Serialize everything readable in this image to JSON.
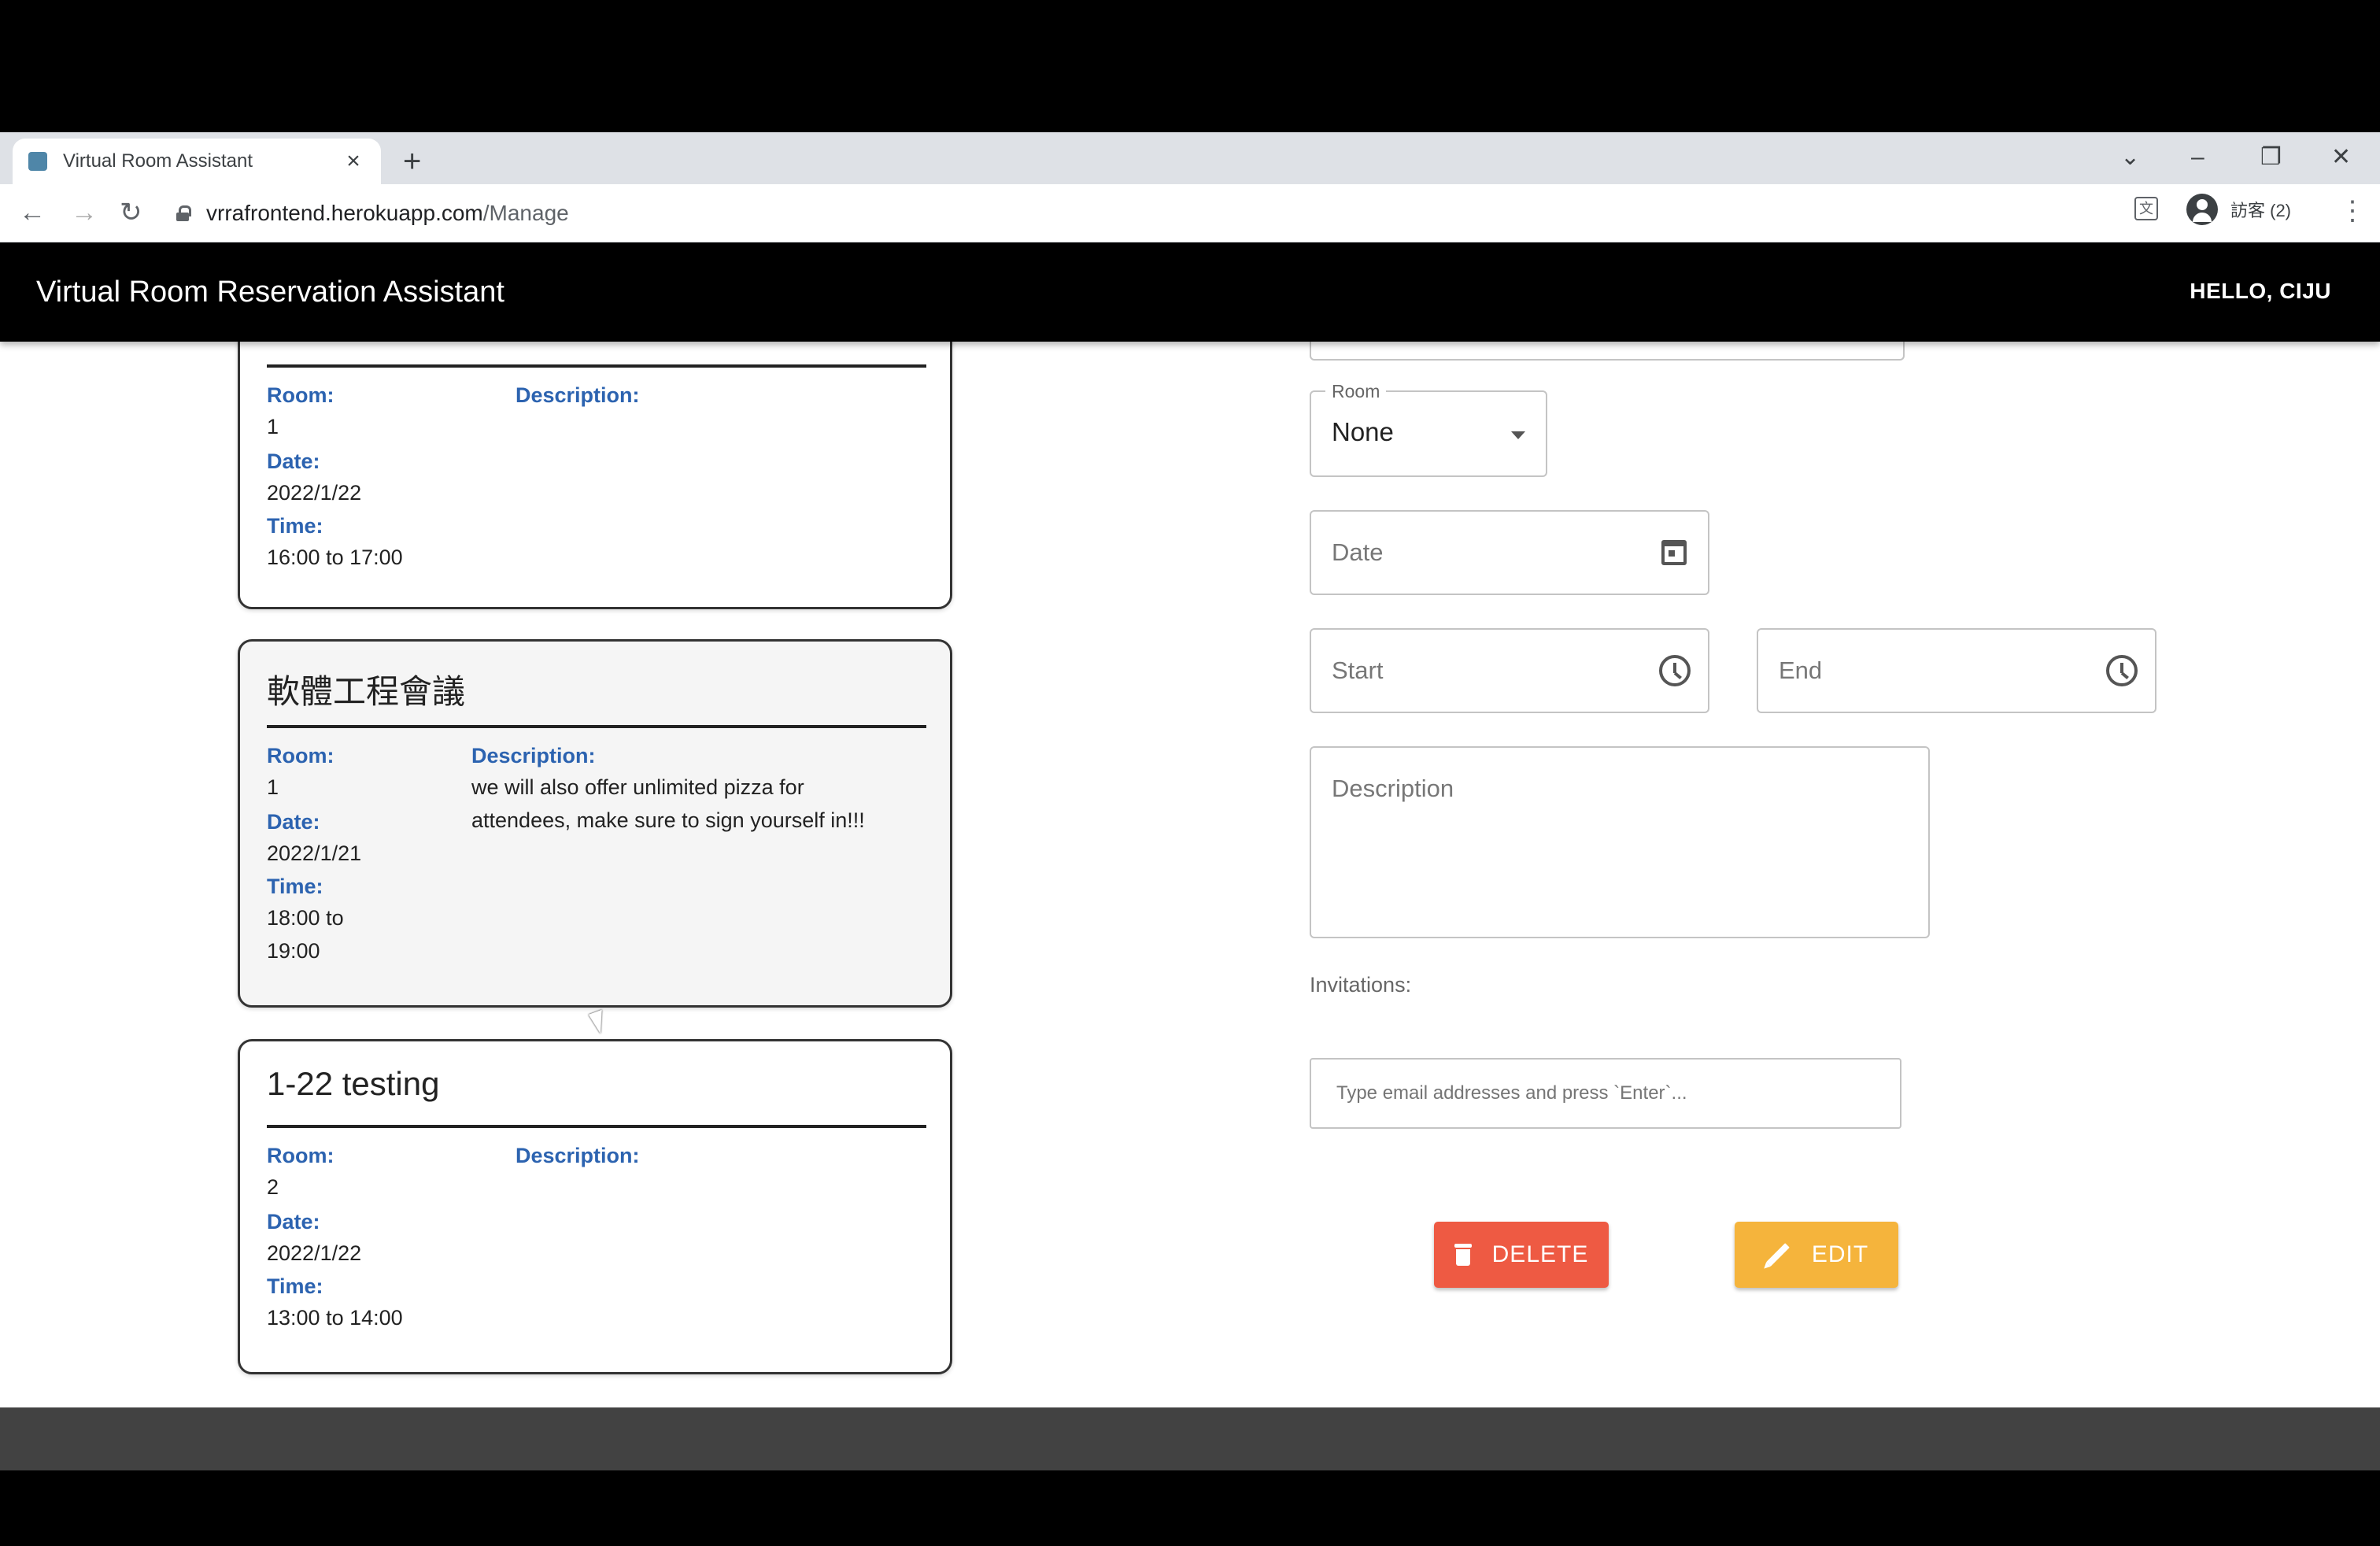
{
  "browser": {
    "tab_title": "Virtual Room Assistant",
    "tab_close": "×",
    "new_tab": "+",
    "url_host": "vrrafrontend.herokuapp.com",
    "url_path": "/Manage",
    "profile_label": "訪客 (2)",
    "window_controls": {
      "dropdown": "⌄",
      "minimize": "–",
      "restore": "❐",
      "close": "✕"
    },
    "nav": {
      "back": "←",
      "forward": "→",
      "reload": "↻"
    },
    "menu": "⋮",
    "translate": "文"
  },
  "appbar": {
    "title": "Virtual Room Reservation Assistant",
    "greeting": "HELLO, CIJU"
  },
  "labels": {
    "room": "Room:",
    "description": "Description:",
    "date": "Date:",
    "time": "Time:"
  },
  "meetings": [
    {
      "title": "",
      "room": "1",
      "date": "2022/1/22",
      "time": "16:00 to 17:00",
      "description": ""
    },
    {
      "title": "軟體工程會議",
      "room": "1",
      "date": "2022/1/21",
      "time_line1": "18:00 to",
      "time_line2": "19:00",
      "description_line1": "we will also offer unlimited pizza for",
      "description_line2": "attendees, make sure to sign yourself in!!!"
    },
    {
      "title": "1-22 testing",
      "room": "2",
      "date": "2022/1/22",
      "time": "13:00 to 14:00",
      "description": ""
    }
  ],
  "form": {
    "room_label": "Room",
    "room_value": "None",
    "date_placeholder": "Date",
    "start_placeholder": "Start",
    "end_placeholder": "End",
    "description_placeholder": "Description",
    "invitations_label": "Invitations:",
    "email_placeholder": "Type email addresses and press `Enter`..."
  },
  "buttons": {
    "delete": "DELETE",
    "edit": "EDIT"
  },
  "colors": {
    "appbar": "#000000",
    "label_blue": "#2c63b0",
    "delete": "#ee5a43",
    "edit": "#f5b43c",
    "footer": "#424242"
  },
  "icons": [
    "calendar-icon",
    "clock-icon",
    "trash-icon",
    "pencil-icon",
    "lock-icon",
    "account-icon"
  ]
}
